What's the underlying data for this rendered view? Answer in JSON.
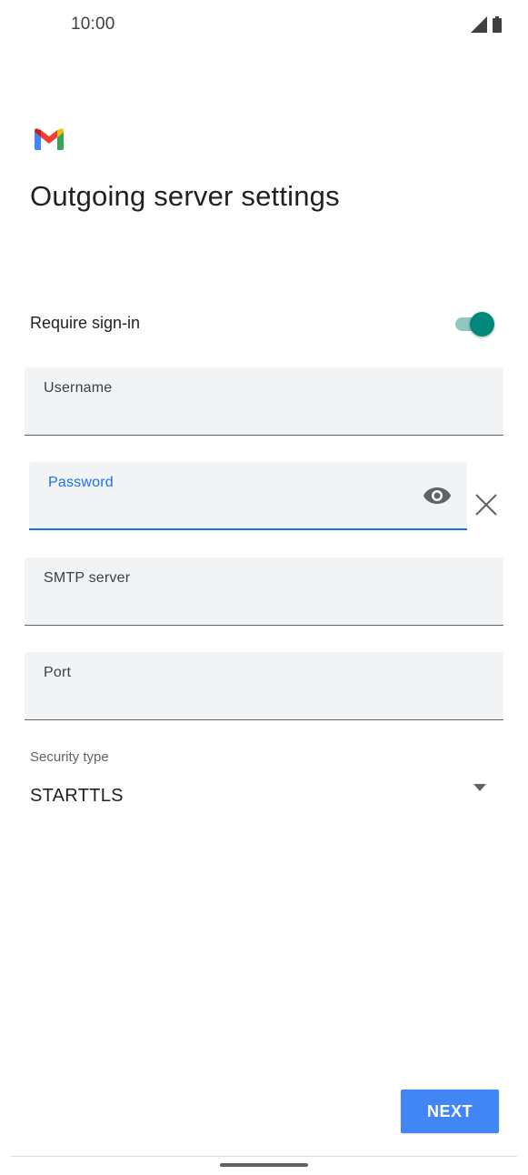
{
  "status_bar": {
    "time": "10:00",
    "icons": [
      "signal-icon",
      "battery-icon"
    ]
  },
  "header": {
    "logo": "gmail-logo",
    "title": "Outgoing server settings"
  },
  "require_signin": {
    "label": "Require sign-in",
    "enabled": true
  },
  "fields": {
    "username": {
      "label": "Username",
      "value": ""
    },
    "password": {
      "label": "Password",
      "value": "",
      "focused": true
    },
    "smtp_server": {
      "label": "SMTP server",
      "value": ""
    },
    "port": {
      "label": "Port",
      "value": ""
    }
  },
  "security": {
    "label": "Security type",
    "value": "STARTTLS"
  },
  "actions": {
    "next_label": "NEXT"
  },
  "colors": {
    "accent": "#1a73e8",
    "toggle_on": "#00897b",
    "button": "#4285f4",
    "field_bg": "#f1f3f4"
  }
}
